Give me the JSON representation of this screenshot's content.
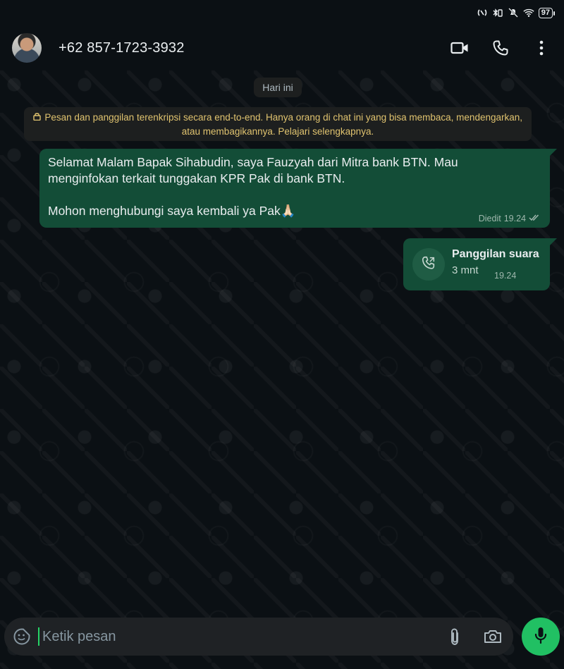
{
  "status_bar": {
    "battery_level": "97"
  },
  "header": {
    "contact": "+62 857-1723-3932",
    "actions": [
      "video-call-icon",
      "voice-call-icon",
      "more-options-icon"
    ]
  },
  "chat": {
    "date_chip": "Hari ini",
    "encryption_notice": "Pesan dan panggilan terenkripsi secara end-to-end. Hanya orang di chat ini yang bisa membaca, mendengarkan, atau membagikannya. Pelajari selengkapnya.",
    "messages": [
      {
        "text": "Selamat Malam Bapak Sihabudin, saya Fauzyah dari Mitra bank BTN. Mau menginfokan terkait tunggakan KPR Pak di bank BTN.\n\nMohon menghubungi saya kembali ya Pak🙏🏻",
        "edited_label": "Diedit",
        "time": "19.24",
        "status": "read"
      }
    ],
    "call": {
      "title": "Panggilan suara",
      "duration": "3 mnt",
      "time": "19.24"
    }
  },
  "composer": {
    "placeholder": "Ketik pesan"
  },
  "colors": {
    "outgoing_bubble": "#134d37",
    "accent": "#21c063",
    "notice_text": "#e0c36f"
  }
}
